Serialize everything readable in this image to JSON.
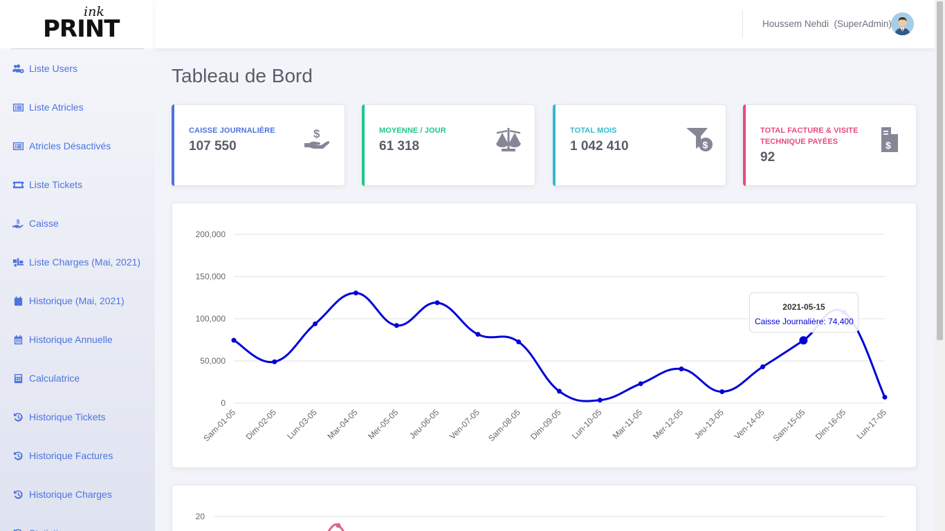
{
  "brand": {
    "ink": "ink",
    "print": "PRINT"
  },
  "user": {
    "name": "Houssem Nehdi  (SuperAdmin)"
  },
  "page_title": "Tableau de Bord",
  "sidebar": {
    "items": [
      {
        "label": "Liste Users",
        "icon": "users-cog-icon"
      },
      {
        "label": "Liste Atricles",
        "icon": "list-alt-icon"
      },
      {
        "label": "Atricles Désactivés",
        "icon": "list-alt-icon"
      },
      {
        "label": "Liste Tickets",
        "icon": "ticket-icon"
      },
      {
        "label": "Caisse",
        "icon": "hand-dollar-icon"
      },
      {
        "label": "Liste Charges (Mai, 2021)",
        "icon": "truck-loading-icon"
      },
      {
        "label": "Historique (Mai, 2021)",
        "icon": "calendar-icon"
      },
      {
        "label": "Historique Annuelle",
        "icon": "calendar-alt-icon"
      },
      {
        "label": "Calculatrice",
        "icon": "calculator-icon"
      },
      {
        "label": "Historique Tickets",
        "icon": "history-icon"
      },
      {
        "label": "Historique Factures",
        "icon": "history-icon"
      },
      {
        "label": "Historique Charges",
        "icon": "history-icon"
      },
      {
        "label": "Statistiques",
        "icon": "history-icon"
      }
    ]
  },
  "cards": [
    {
      "label": "CAISSE JOURNALIÈRE",
      "value": "107 550",
      "color": "#4e73df",
      "icon": "hand-dollar-icon"
    },
    {
      "label": "MOYENNE / JOUR",
      "value": "61 318",
      "color": "#1cc88a",
      "icon": "balance-scale-icon"
    },
    {
      "label": "TOTAL MOIS",
      "value": "1 042 410",
      "color": "#36b9cc",
      "icon": "funnel-dollar-icon"
    },
    {
      "label": "TOTAL FACTURE & VISITE TECHNIQUE PAYÉES",
      "value": "92",
      "color": "#e74a7b",
      "icon": "file-invoice-dollar-icon"
    }
  ],
  "chart_data": [
    {
      "type": "line",
      "categories": [
        "Sam-01-05",
        "Dim-02-05",
        "Lun-03-05",
        "Mar-04-05",
        "Mer-05-05",
        "Jeu-06-05",
        "Ven-07-05",
        "Sam-08-05",
        "Dim-09-05",
        "Lun-10-05",
        "Mar-11-05",
        "Mer-12-05",
        "Jeu-13-05",
        "Ven-14-05",
        "Sam-15-05",
        "Dim-16-05",
        "Lun-17-05"
      ],
      "series": [
        {
          "name": "Caisse Journalière",
          "values": [
            74500,
            49000,
            94000,
            130500,
            92000,
            119000,
            81500,
            72500,
            14000,
            3500,
            23000,
            40500,
            13500,
            43000,
            74400,
            107550,
            7000
          ]
        }
      ],
      "ylim": [
        0,
        200000
      ],
      "yticks": [
        "0",
        "50,000",
        "100,000",
        "150,000",
        "200,000"
      ],
      "line_color": "#0000d8",
      "tooltip": {
        "title": "2021-05-15",
        "body": "Caisse Journalière: 74,400",
        "index": 14
      }
    },
    {
      "type": "line",
      "yticks": [
        "20"
      ],
      "line_color": "#d9668f"
    }
  ],
  "colors": {
    "primary": "#4e73df",
    "success": "#1cc88a",
    "info": "#36b9cc",
    "danger": "#e74a7b"
  }
}
